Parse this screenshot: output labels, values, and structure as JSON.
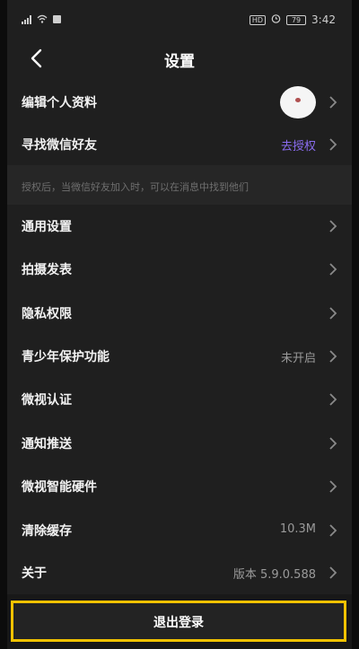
{
  "status_bar": {
    "left_icons": [
      "signal-icon",
      "wifi-icon",
      "notification-icon"
    ],
    "hd_badge": "HD",
    "battery": "79",
    "time": "3:42"
  },
  "header": {
    "title": "设置"
  },
  "settings": {
    "edit_profile": "编辑个人资料",
    "find_friends": "寻找微信好友",
    "find_friends_value": "去授权",
    "auth_hint": "授权后，当微信好友加入时，可以在消息中找到他们",
    "general": "通用设置",
    "capture_publish": "拍摄发表",
    "privacy": "隐私权限",
    "youth_mode": "青少年保护功能",
    "youth_mode_value": "未开启",
    "certification": "微视认证",
    "notifications": "通知推送",
    "smart_hardware": "微视智能硬件",
    "clear_cache": "清除缓存",
    "clear_cache_value": "10.3M",
    "about": "关于",
    "about_value": "版本 5.9.0.588"
  },
  "logout": {
    "label": "退出登录"
  },
  "colors": {
    "accent": "#8a6cf0",
    "highlight_border": "#f2c200",
    "background": "#1f1f1f"
  }
}
